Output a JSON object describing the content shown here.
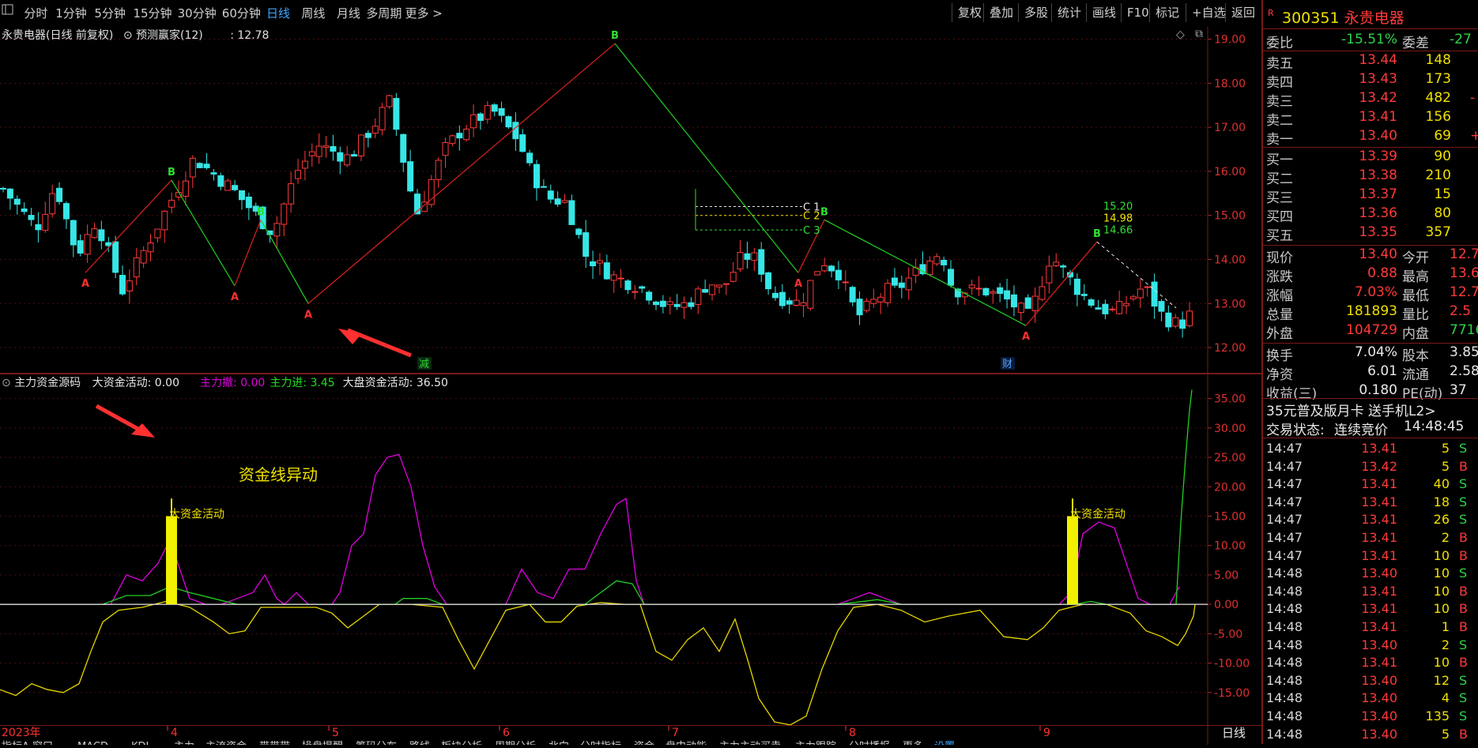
{
  "toolbar": {
    "periods": [
      "分时",
      "1分钟",
      "5分钟",
      "15分钟",
      "30分钟",
      "60分钟",
      "日线",
      "周线",
      "月线",
      "多周期",
      "更多 >"
    ],
    "active_period": "日线",
    "right_buttons": [
      "复权",
      "叠加",
      "多股",
      "统计",
      "画线",
      "F10",
      "标记",
      "+自选",
      "返回"
    ]
  },
  "main_chart": {
    "title": "永贵电器(日线 前复权)",
    "indicator_name": "预测赢家(12)",
    "indicator_value": ": 12.78",
    "price_axis": [
      "19.00",
      "18.00",
      "17.00",
      "16.00",
      "15.00",
      "14.00",
      "13.00",
      "12.00"
    ],
    "price_range": [
      11.75,
      19.1
    ],
    "levels": [
      {
        "label": "C 1",
        "price": 15.2
      },
      {
        "label": "C 2",
        "price": 15.0
      },
      {
        "label": "C 3",
        "price": 14.67
      }
    ],
    "peak_labels": [
      "15.20",
      "14.98",
      "14.66"
    ],
    "markers": {
      "A": "A",
      "B": "B"
    },
    "event_tags": [
      "减",
      "财"
    ]
  },
  "indicator_panel": {
    "title": "主力资金源码",
    "items": [
      {
        "label": "大资金活动: 0.00",
        "color": "#e8e8e8"
      },
      {
        "label": "主力撤: 0.00",
        "color": "#e000e0"
      },
      {
        "label": "主力进: 3.45",
        "color": "#20e020"
      },
      {
        "label": "大盘资金活动: 36.50",
        "color": "#e8e8e8"
      }
    ],
    "axis": [
      "35.00",
      "30.00",
      "25.00",
      "20.00",
      "15.00",
      "10.00",
      "5.00",
      "0.00",
      "-5.00",
      "-10.00",
      "-15.00"
    ],
    "range": [
      -20,
      37.5
    ],
    "annotation": "资金线异动",
    "bar_label": "大资金活动"
  },
  "time_axis": {
    "labels": [
      "2023年",
      "4",
      "5",
      "6",
      "7",
      "8",
      "9"
    ],
    "right_label": "日线"
  },
  "bottom_tabs": [
    "指标A 窗口",
    "MACD",
    "KDJ",
    "主力",
    "主流资金",
    "带带带",
    "操盘提醒",
    "筹码分布",
    "路线",
    "板块分析",
    "周期分析",
    "北向",
    "分时指标",
    "资金",
    "盘中动能",
    "主力主动买卖",
    "主力跟踪",
    "分时播报",
    "更多",
    "设置"
  ],
  "quote": {
    "code": "300351",
    "name": "永贵电器",
    "weibi": {
      "label": "委比",
      "value": "-15.51%",
      "label2": "委差",
      "value2": "-27"
    },
    "asks": [
      {
        "label": "卖五",
        "price": "13.44",
        "vol": "148",
        "chg": ""
      },
      {
        "label": "卖四",
        "price": "13.43",
        "vol": "173",
        "chg": ""
      },
      {
        "label": "卖三",
        "price": "13.42",
        "vol": "482",
        "chg": "-"
      },
      {
        "label": "卖二",
        "price": "13.41",
        "vol": "156",
        "chg": ""
      },
      {
        "label": "卖一",
        "price": "13.40",
        "vol": "69",
        "chg": "+"
      }
    ],
    "bids": [
      {
        "label": "买一",
        "price": "13.39",
        "vol": "90"
      },
      {
        "label": "买二",
        "price": "13.38",
        "vol": "210"
      },
      {
        "label": "买三",
        "price": "13.37",
        "vol": "15"
      },
      {
        "label": "买四",
        "price": "13.36",
        "vol": "80"
      },
      {
        "label": "买五",
        "price": "13.35",
        "vol": "357"
      }
    ],
    "stats": [
      {
        "l1": "现价",
        "v1": "13.40",
        "c1": "red",
        "l2": "今开",
        "v2": "12.7",
        "c2": "red"
      },
      {
        "l1": "涨跌",
        "v1": "0.88",
        "c1": "red",
        "l2": "最高",
        "v2": "13.6",
        "c2": "red"
      },
      {
        "l1": "涨幅",
        "v1": "7.03%",
        "c1": "red",
        "l2": "最低",
        "v2": "12.7",
        "c2": "red"
      },
      {
        "l1": "总量",
        "v1": "181893",
        "c1": "yellow",
        "l2": "量比",
        "v2": "2.5",
        "c2": "red"
      },
      {
        "l1": "外盘",
        "v1": "104729",
        "c1": "red",
        "l2": "内盘",
        "v2": "7716",
        "c2": "green"
      }
    ],
    "fin": [
      {
        "l1": "换手",
        "v1": "7.04%",
        "l2": "股本",
        "v2": "3.85"
      },
      {
        "l1": "净资",
        "v1": "6.01",
        "l2": "流通",
        "v2": "2.58"
      },
      {
        "l1": "收益(三)",
        "v1": "0.180",
        "l2": "PE(动)",
        "v2": "37"
      }
    ],
    "promo": "35元普及版月卡 送手机L2>",
    "trade_status_label": "交易状态:",
    "trade_status": "连续竞价",
    "trade_time": "14:48:45",
    "ticks": [
      {
        "t": "14:47",
        "p": "13.41",
        "v": "5",
        "s": "S"
      },
      {
        "t": "14:47",
        "p": "13.42",
        "v": "5",
        "s": "B"
      },
      {
        "t": "14:47",
        "p": "13.41",
        "v": "40",
        "s": "S"
      },
      {
        "t": "14:47",
        "p": "13.41",
        "v": "18",
        "s": "S"
      },
      {
        "t": "14:47",
        "p": "13.41",
        "v": "26",
        "s": "S"
      },
      {
        "t": "14:47",
        "p": "13.41",
        "v": "2",
        "s": "B"
      },
      {
        "t": "14:47",
        "p": "13.41",
        "v": "10",
        "s": "B"
      },
      {
        "t": "14:48",
        "p": "13.40",
        "v": "10",
        "s": "S"
      },
      {
        "t": "14:48",
        "p": "13.41",
        "v": "10",
        "s": "B"
      },
      {
        "t": "14:48",
        "p": "13.41",
        "v": "10",
        "s": "B"
      },
      {
        "t": "14:48",
        "p": "13.41",
        "v": "1",
        "s": "B"
      },
      {
        "t": "14:48",
        "p": "13.40",
        "v": "2",
        "s": "S"
      },
      {
        "t": "14:48",
        "p": "13.41",
        "v": "10",
        "s": "B"
      },
      {
        "t": "14:48",
        "p": "13.40",
        "v": "12",
        "s": "S"
      },
      {
        "t": "14:48",
        "p": "13.40",
        "v": "4",
        "s": "S"
      },
      {
        "t": "14:48",
        "p": "13.40",
        "v": "135",
        "s": "S"
      },
      {
        "t": "14:48",
        "p": "13.40",
        "v": "5",
        "s": "B"
      }
    ]
  },
  "colors": {
    "up": "#ff3a3a",
    "down": "#36e6e6",
    "grid": "#7a1a1a",
    "zigzag_up": "#e02020",
    "zigzag_down": "#20d020"
  }
}
